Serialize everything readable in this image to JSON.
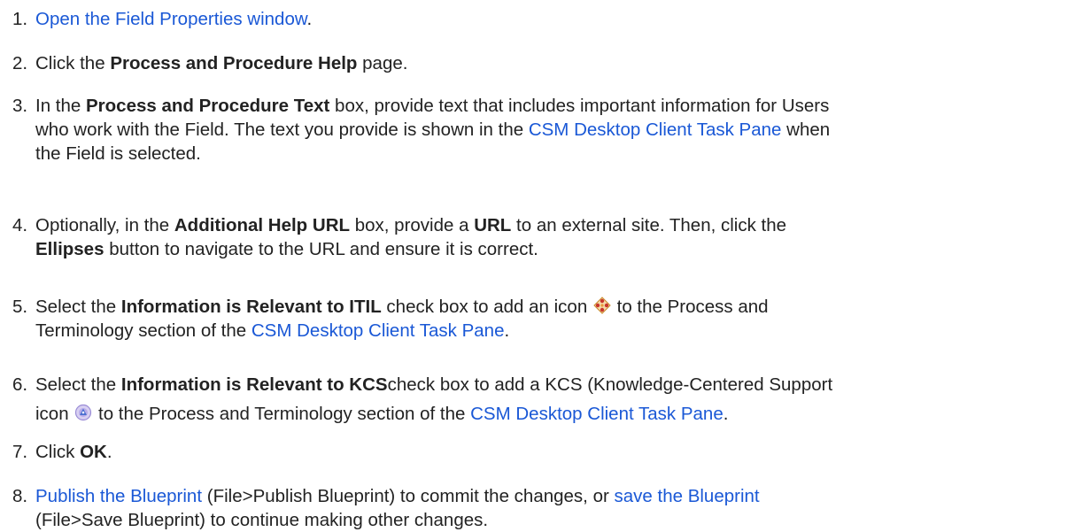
{
  "steps": [
    {
      "num": "1.",
      "link": "Open the Field Properties window",
      "end": "."
    },
    {
      "num": "2.",
      "pre": "Click the ",
      "bold": "Process and Procedure Help",
      "post": " page."
    },
    {
      "num": "3.",
      "pre": "In the ",
      "bold": "Process and Procedure Text",
      "line1_rest": " box, provide text that includes important information for Users",
      "line2_pre": "who work with the Field. The text you provide is shown in the ",
      "link": "CSM Desktop Client Task Pane",
      "line2_post": " when",
      "line3": "the Field is selected."
    },
    {
      "num": "4.",
      "pre": "Optionally, in the ",
      "bold1": "Additional Help URL",
      "mid": " box, provide a ",
      "bold2": "URL",
      "line1_rest": " to an external site. Then, click the",
      "bold3": "Ellipses",
      "line2_rest": " button to navigate to the URL and ensure it is correct."
    },
    {
      "num": "5.",
      "pre": "Select the ",
      "bold": "Information is Relevant to ITIL",
      "mid": " check box to add an icon ",
      "icon": "itil-diamond-icon",
      "line1_rest": " to the Process and",
      "line2_pre": "Terminology section of the ",
      "link": "CSM Desktop Client Task Pane",
      "end": "."
    },
    {
      "num": "6.",
      "pre": "Select the ",
      "bold": "Information is Relevant to KCS",
      "line1_rest": "check box to add a KCS (Knowledge-Centered Support",
      "line2_pre": "icon ",
      "icon": "kcs-globe-icon",
      "line2_mid": " to the Process and Terminology section of the ",
      "link": "CSM Desktop Client Task Pane",
      "end": "."
    },
    {
      "num": "7.",
      "pre": "Click ",
      "bold": "OK",
      "end": "."
    },
    {
      "num": "8.",
      "link1": "Publish the Blueprint",
      "mid1": " (File>Publish Blueprint) to commit the changes, or ",
      "link2": "save the Blueprint",
      "line2": "(File>Save Blueprint) to continue making other changes."
    }
  ],
  "colors": {
    "text": "#222222",
    "link": "#1a58d6",
    "itil_icon": "#c8362b",
    "kcs_icon": "#9a8cd6"
  }
}
